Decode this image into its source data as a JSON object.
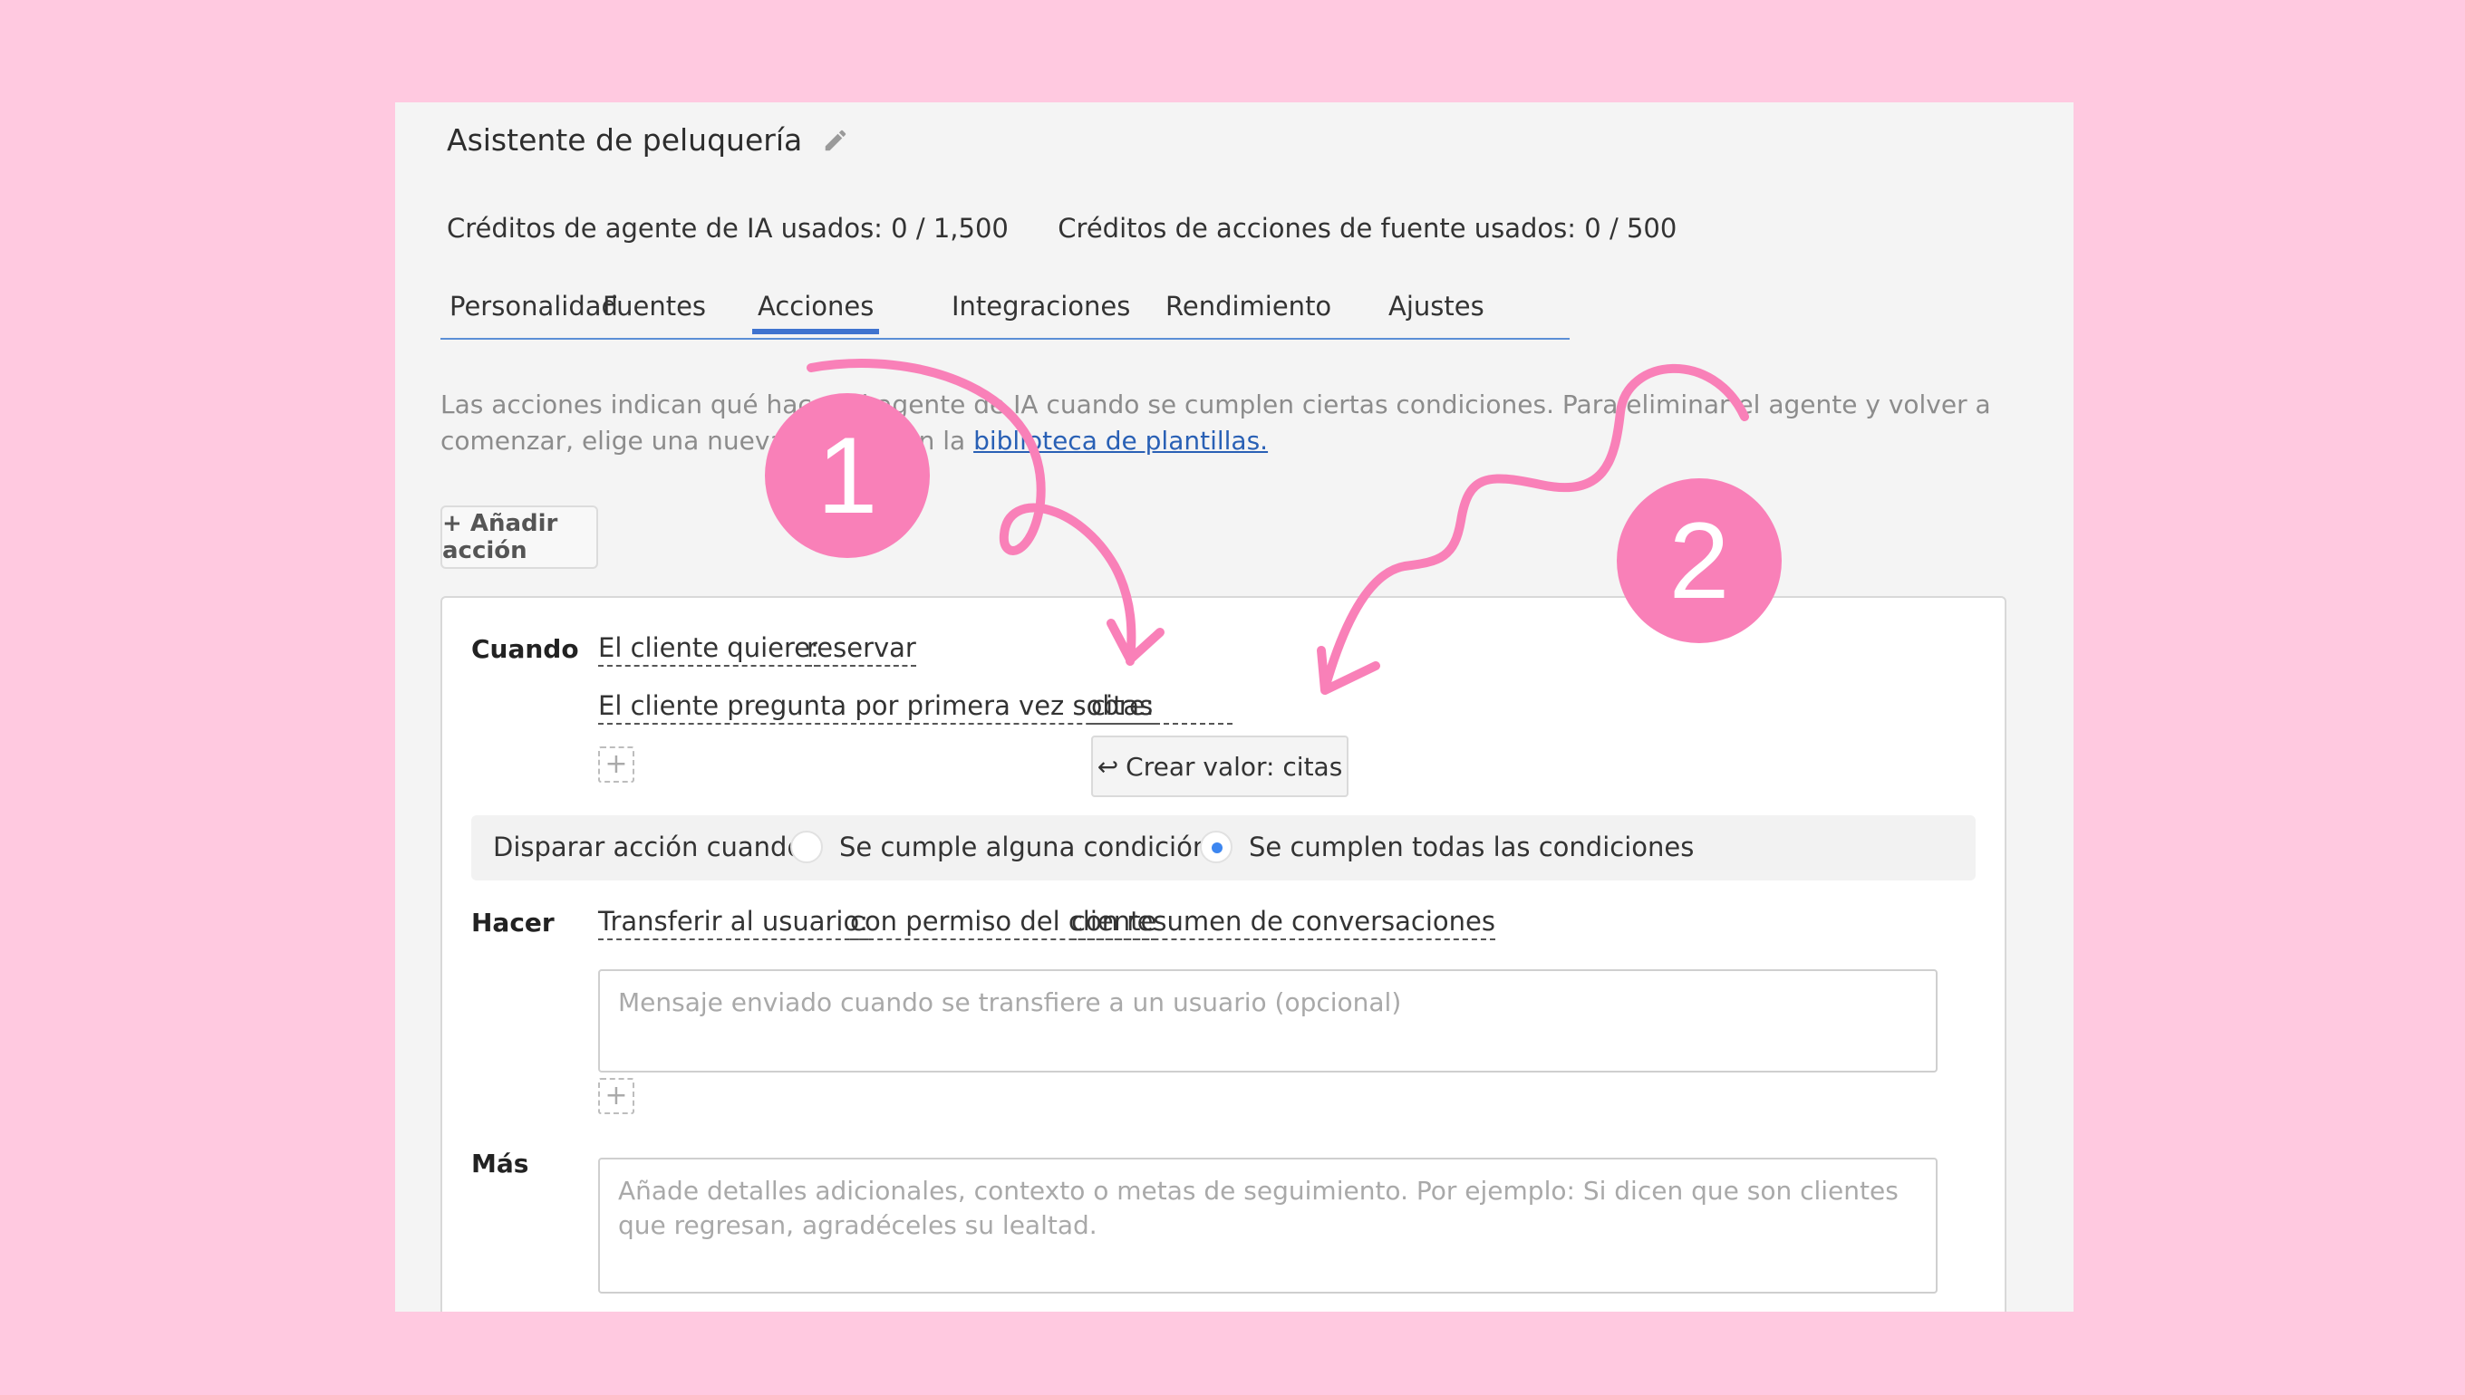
{
  "header": {
    "title": "Asistente de peluquería",
    "credits_ai_label": "Créditos de agente de IA usados:",
    "credits_ai_value": "0 / 1,500",
    "credits_source_label": "Créditos de acciones de fuente usados:",
    "credits_source_value": "0 / 500"
  },
  "tabs": [
    {
      "label": "Personalidad"
    },
    {
      "label": "Fuentes"
    },
    {
      "label": "Acciones"
    },
    {
      "label": "Integraciones"
    },
    {
      "label": "Rendimiento"
    },
    {
      "label": "Ajustes"
    }
  ],
  "active_tab": "Acciones",
  "description": {
    "text": "Las acciones indican qué hacer al agente de IA cuando se cumplen ciertas condiciones. Para eliminar el agente y volver a comenzar, elige una nueva plantilla en la ",
    "link": "biblioteca de plantillas."
  },
  "add_action_label": "+ Añadir acción",
  "action": {
    "when_label": "Cuando",
    "condition1_key": "El cliente quiere:",
    "condition1_value": "reservar",
    "condition2_key": "El cliente pregunta por primera vez sobre:",
    "condition2_value": "citas",
    "suggestion": "Crear valor: citas",
    "trigger_label": "Disparar acción cuando:",
    "trigger_option_any": "Se cumple alguna condición",
    "trigger_option_all": "Se cumplen todas las condiciones",
    "trigger_selected": "Se cumplen todas las condiciones",
    "do_label": "Hacer",
    "do_key": "Transferir al usuario:",
    "do_value1": "con permiso del cliente",
    "do_value2": "con resumen de conversaciones",
    "transfer_placeholder": "Mensaje enviado cuando se transfiere a un usuario (opcional)",
    "more_label": "Más",
    "more_placeholder": "Añade detalles adicionales, contexto o metas de seguimiento. Por ejemplo: Si dicen que son clientes que regresan, agradéceles su lealtad."
  },
  "annotations": {
    "badge1": "1",
    "badge2": "2",
    "color": "#f980b8"
  },
  "colors": {
    "background": "#ffc9e0",
    "accent": "#3f73cf",
    "link": "#2960b5"
  }
}
